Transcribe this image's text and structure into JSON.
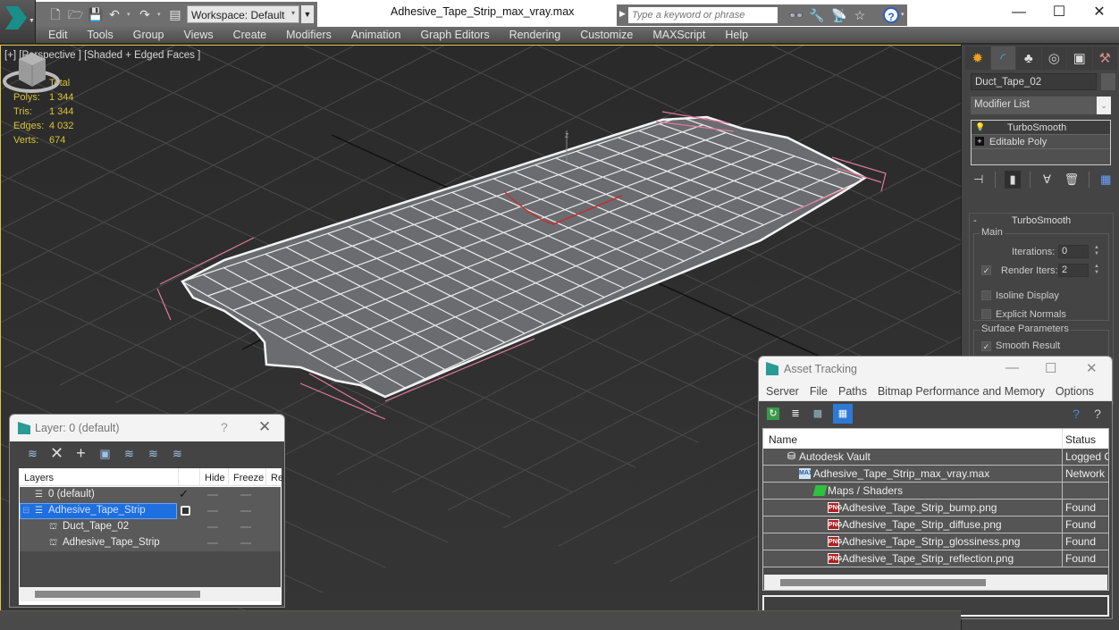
{
  "app": {
    "title": "Adhesive_Tape_Strip_max_vray.max",
    "workspace": "Workspace: Default",
    "search_placeholder": "Type a keyword or phrase",
    "window_controls": {
      "minimize": "—",
      "maximize": "☐",
      "close": "✕"
    }
  },
  "quick_access": [
    {
      "icon": "new-file-icon",
      "glyph": "🗋"
    },
    {
      "icon": "open-folder-icon",
      "glyph": "🗁"
    },
    {
      "icon": "save-icon",
      "glyph": "💾"
    },
    {
      "icon": "undo-icon",
      "glyph": "↶"
    },
    {
      "icon": "redo-icon",
      "glyph": "↷"
    },
    {
      "icon": "project-folder-icon",
      "glyph": "▤"
    }
  ],
  "menu": [
    "Edit",
    "Tools",
    "Group",
    "Views",
    "Create",
    "Modifiers",
    "Animation",
    "Graph Editors",
    "Rendering",
    "Customize",
    "MAXScript",
    "Help"
  ],
  "viewport": {
    "label": "[+] [Perspective ] [Shaded + Edged Faces ]",
    "stats": {
      "header": "Total",
      "rows": [
        {
          "label": "Polys:",
          "value": "1 344"
        },
        {
          "label": "Tris:",
          "value": "1 344"
        },
        {
          "label": "Edges:",
          "value": "4 032"
        },
        {
          "label": "Verts:",
          "value": "674"
        }
      ]
    },
    "axis_label": "z"
  },
  "command_panel": {
    "object_name": "Duct_Tape_02",
    "modifier_list": "Modifier List",
    "stack": [
      {
        "name": "TurboSmooth",
        "icon": "lightbulb-icon",
        "selected": true
      },
      {
        "name": "Editable Poly",
        "icon": "expand-plus-icon",
        "selected": false
      }
    ],
    "turbosmooth": {
      "title": "TurboSmooth",
      "main_group": "Main",
      "iterations_label": "Iterations:",
      "iterations_value": "0",
      "render_iters_label": "Render Iters:",
      "render_iters_value": "2",
      "render_iters_checked": true,
      "isoline_label": "Isoline Display",
      "isoline_checked": false,
      "explicit_normals_label": "Explicit Normals",
      "explicit_normals_checked": false,
      "surface_group": "Surface Parameters",
      "smooth_result_label": "Smooth Result",
      "smooth_result_checked": true
    }
  },
  "layer_dialog": {
    "title": "Layer: 0 (default)",
    "help": "?",
    "close": "✕",
    "columns": [
      "Layers",
      "Hide",
      "Freeze",
      "Re"
    ],
    "rows": [
      {
        "name": "0 (default)",
        "type": "layer",
        "level": 0,
        "current": true,
        "selected": false
      },
      {
        "name": "Adhesive_Tape_Strip",
        "type": "layer",
        "level": 0,
        "current": false,
        "selected": true
      },
      {
        "name": "Duct_Tape_02",
        "type": "object",
        "level": 1,
        "current": false,
        "selected": false
      },
      {
        "name": "Adhesive_Tape_Strip",
        "type": "object",
        "level": 1,
        "current": false,
        "selected": false
      }
    ]
  },
  "asset_dialog": {
    "title": "Asset Tracking",
    "menu": [
      "Server",
      "File",
      "Paths",
      "Bitmap Performance and Memory",
      "Options"
    ],
    "columns": [
      "Name",
      "Status"
    ],
    "rows": [
      {
        "name": "Autodesk Vault",
        "status": "Logged Out",
        "icon": "vault-icon",
        "level": 1
      },
      {
        "name": "Adhesive_Tape_Strip_max_vray.max",
        "status": "Network",
        "icon": "max-file-icon",
        "level": 2
      },
      {
        "name": "Maps / Shaders",
        "status": "",
        "icon": "maps-icon",
        "level": 3
      },
      {
        "name": "Adhesive_Tape_Strip_bump.png",
        "status": "Found",
        "icon": "png-icon",
        "level": 4
      },
      {
        "name": "Adhesive_Tape_Strip_diffuse.png",
        "status": "Found",
        "icon": "png-icon",
        "level": 4
      },
      {
        "name": "Adhesive_Tape_Strip_glossiness.png",
        "status": "Found",
        "icon": "png-icon",
        "level": 4
      },
      {
        "name": "Adhesive_Tape_Strip_reflection.png",
        "status": "Found",
        "icon": "png-icon",
        "level": 4
      }
    ],
    "path_value": ""
  },
  "colors": {
    "accent_blue": "#1e6fe0",
    "stats_yellow": "#d8c33a",
    "selection_pink": "#e07a9a",
    "logo_teal": "#1a8f8a"
  }
}
